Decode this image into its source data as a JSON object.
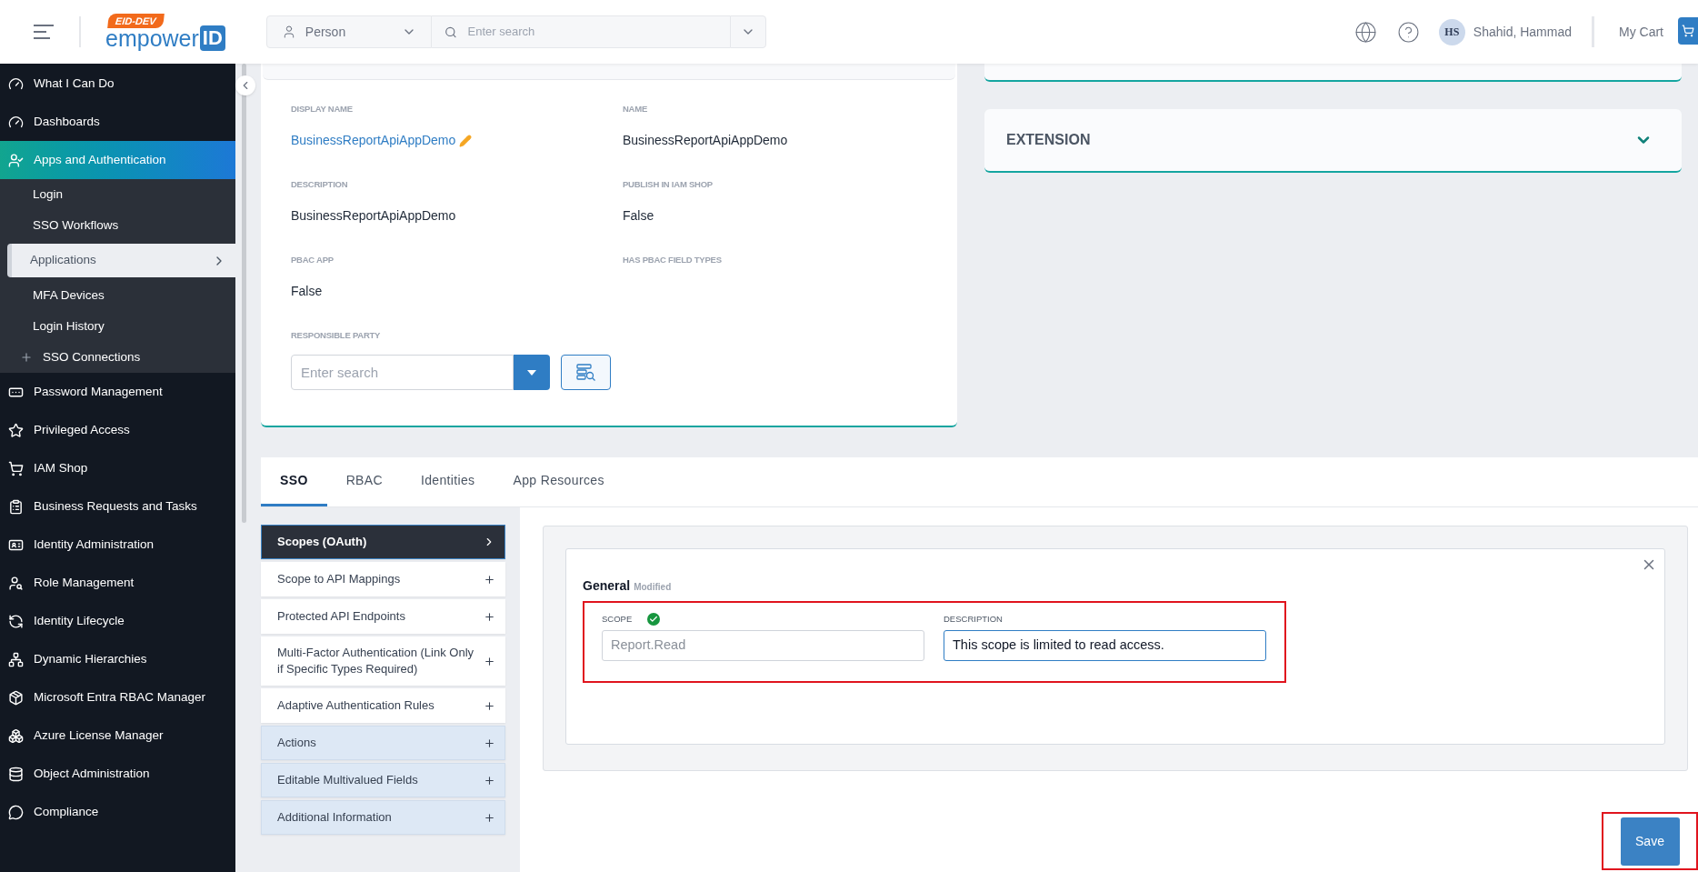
{
  "header": {
    "logo": {
      "badge": "EID-DEV",
      "text": "empower",
      "box": "ID"
    },
    "search": {
      "type": "Person",
      "placeholder": "Enter search"
    },
    "user": {
      "initials": "HS",
      "name": "Shahid, Hammad"
    },
    "cart": "My Cart"
  },
  "sidebar": {
    "items": [
      {
        "label": "What I Can Do",
        "selected": false
      },
      {
        "label": "Dashboards",
        "selected": false
      },
      {
        "label": "Apps and Authentication",
        "selected": true,
        "children": [
          {
            "label": "Login",
            "selected": false,
            "expandable": false
          },
          {
            "label": "SSO Workflows",
            "selected": false,
            "expandable": false
          },
          {
            "label": "Applications",
            "selected": true,
            "expandable": false
          },
          {
            "label": "MFA Devices",
            "selected": false,
            "expandable": false
          },
          {
            "label": "Login History",
            "selected": false,
            "expandable": false
          },
          {
            "label": "SSO Connections",
            "selected": false,
            "expandable": true
          }
        ]
      },
      {
        "label": "Password Management",
        "selected": false
      },
      {
        "label": "Privileged Access",
        "selected": false
      },
      {
        "label": "IAM Shop",
        "selected": false
      },
      {
        "label": "Business Requests and Tasks",
        "selected": false
      },
      {
        "label": "Identity Administration",
        "selected": false
      },
      {
        "label": "Role Management",
        "selected": false
      },
      {
        "label": "Identity Lifecycle",
        "selected": false
      },
      {
        "label": "Dynamic Hierarchies",
        "selected": false
      },
      {
        "label": "Microsoft Entra RBAC Manager",
        "selected": false
      },
      {
        "label": "Azure License Manager",
        "selected": false
      },
      {
        "label": "Object Administration",
        "selected": false
      },
      {
        "label": "Compliance",
        "selected": false
      }
    ]
  },
  "details": {
    "fields": [
      {
        "label": "DISPLAY NAME",
        "value": "BusinessReportApiAppDemo",
        "kind": "link"
      },
      {
        "label": "NAME",
        "value": "BusinessReportApiAppDemo",
        "kind": "text"
      },
      {
        "label": "DESCRIPTION",
        "value": "BusinessReportApiAppDemo",
        "kind": "text"
      },
      {
        "label": "PUBLISH IN IAM SHOP",
        "value": "False",
        "kind": "text"
      },
      {
        "label": "PBAC APP",
        "value": "False",
        "kind": "text"
      },
      {
        "label": "HAS PBAC FIELD TYPES",
        "kind": "empty"
      }
    ],
    "responsible_party": {
      "label": "RESPONSIBLE PARTY",
      "placeholder": "Enter search"
    }
  },
  "extension": {
    "title": "EXTENSION",
    "expanded": false
  },
  "tabs": [
    {
      "label": "SSO",
      "selected": true
    },
    {
      "label": "RBAC",
      "selected": false
    },
    {
      "label": "Identities",
      "selected": false
    },
    {
      "label": "App Resources",
      "selected": false
    }
  ],
  "sections": [
    {
      "label": "Scopes (OAuth)",
      "selected": true,
      "tinted": false
    },
    {
      "label": "Scope to API Mappings",
      "selected": false,
      "tinted": false
    },
    {
      "label": "Protected API Endpoints",
      "selected": false,
      "tinted": false
    },
    {
      "label": "Multi-Factor Authentication (Link Only if Specific Types Required)",
      "selected": false,
      "tinted": false
    },
    {
      "label": "Adaptive Authentication Rules",
      "selected": false,
      "tinted": false
    },
    {
      "label": "Actions",
      "selected": false,
      "tinted": true
    },
    {
      "label": "Editable Multivalued Fields",
      "selected": false,
      "tinted": true
    },
    {
      "label": "Additional Information",
      "selected": false,
      "tinted": true
    }
  ],
  "editor": {
    "title": "General",
    "status": "Modified",
    "fields": [
      {
        "label": "SCOPE",
        "valid": true,
        "value": "Report.Read",
        "readonly": true,
        "focused": false
      },
      {
        "label": "DESCRIPTION",
        "value": "This scope is limited to read access.",
        "readonly": false,
        "focused": true
      }
    ]
  },
  "save": "Save"
}
